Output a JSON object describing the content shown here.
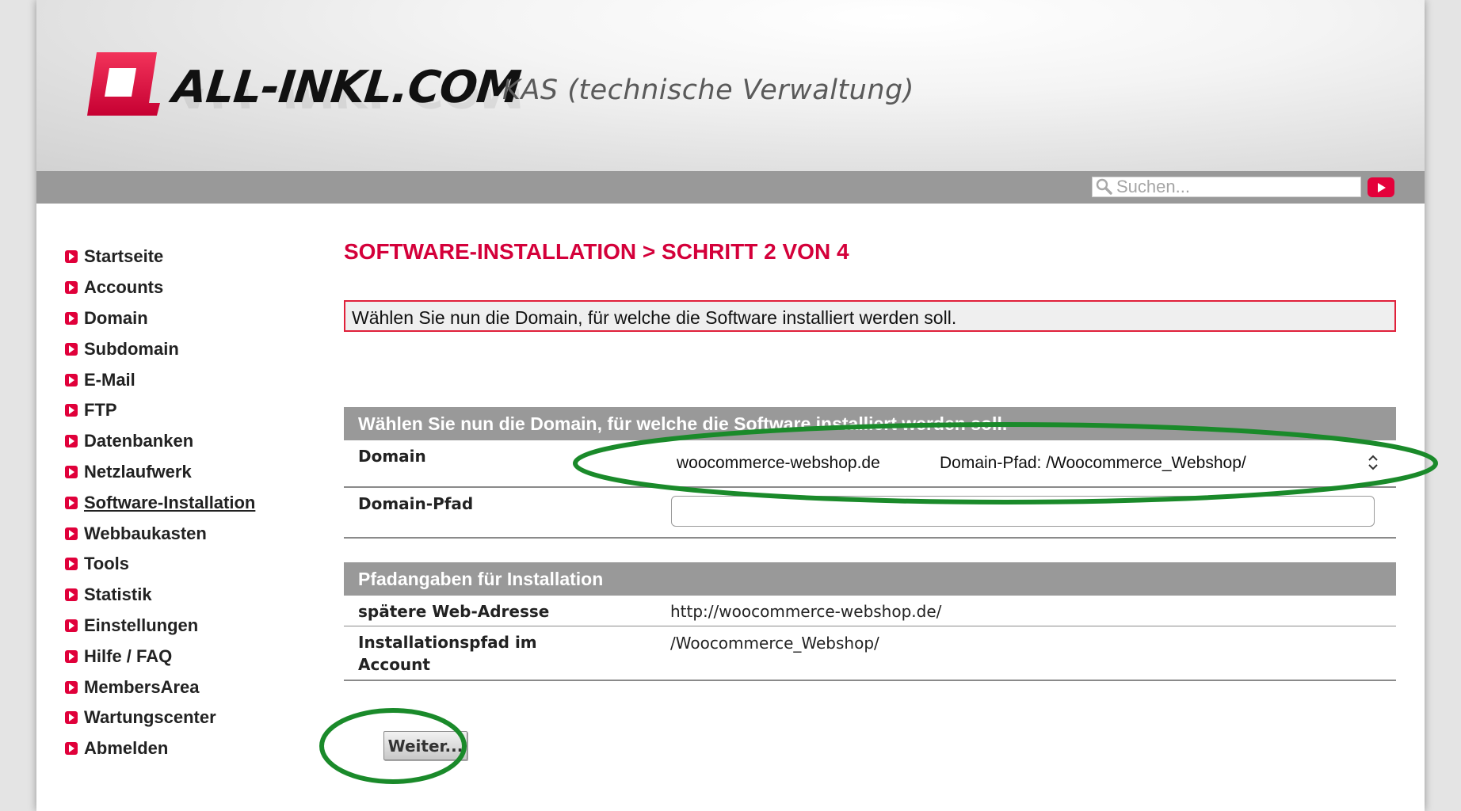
{
  "header": {
    "brand": "ALL-INKL.COM",
    "subtitle": "KAS (technische Verwaltung)"
  },
  "search": {
    "placeholder": "Suchen..."
  },
  "sidebar": {
    "items": [
      {
        "label": "Startseite"
      },
      {
        "label": "Accounts"
      },
      {
        "label": "Domain"
      },
      {
        "label": "Subdomain"
      },
      {
        "label": "E-Mail"
      },
      {
        "label": "FTP"
      },
      {
        "label": "Datenbanken"
      },
      {
        "label": "Netzlaufwerk"
      },
      {
        "label": "Software-Installation",
        "active": true
      },
      {
        "label": "Webbaukasten"
      },
      {
        "label": "Tools"
      },
      {
        "label": "Statistik"
      },
      {
        "label": "Einstellungen"
      },
      {
        "label": "Hilfe / FAQ"
      },
      {
        "label": "MembersArea"
      },
      {
        "label": "Wartungscenter"
      },
      {
        "label": "Abmelden"
      }
    ]
  },
  "main": {
    "title": "SOFTWARE-INSTALLATION > SCHRITT 2 VON 4",
    "info": "Wählen Sie nun die Domain, für welche die Software installiert werden soll.",
    "section1": {
      "header": "Wählen Sie nun die Domain, für welche die Software installiert werden soll.",
      "domain_label": "Domain",
      "domain_value": "woocommerce-webshop.de",
      "domain_path_option": "Domain-Pfad: /Woocommerce_Webshop/",
      "pfad_label": "Domain-Pfad",
      "pfad_value": ""
    },
    "section2": {
      "header": "Pfadangaben für Installation",
      "web_label": "spätere Web-Adresse",
      "web_value": "http://woocommerce-webshop.de/",
      "install_label_1": "Installationspfad im",
      "install_label_2": "Account",
      "install_value": "/Woocommerce_Webshop/"
    },
    "button": "Weiter..."
  },
  "colors": {
    "accent": "#e0003a",
    "title": "#d4003a",
    "bar": "#999999",
    "annotation": "#1a8a2a"
  }
}
